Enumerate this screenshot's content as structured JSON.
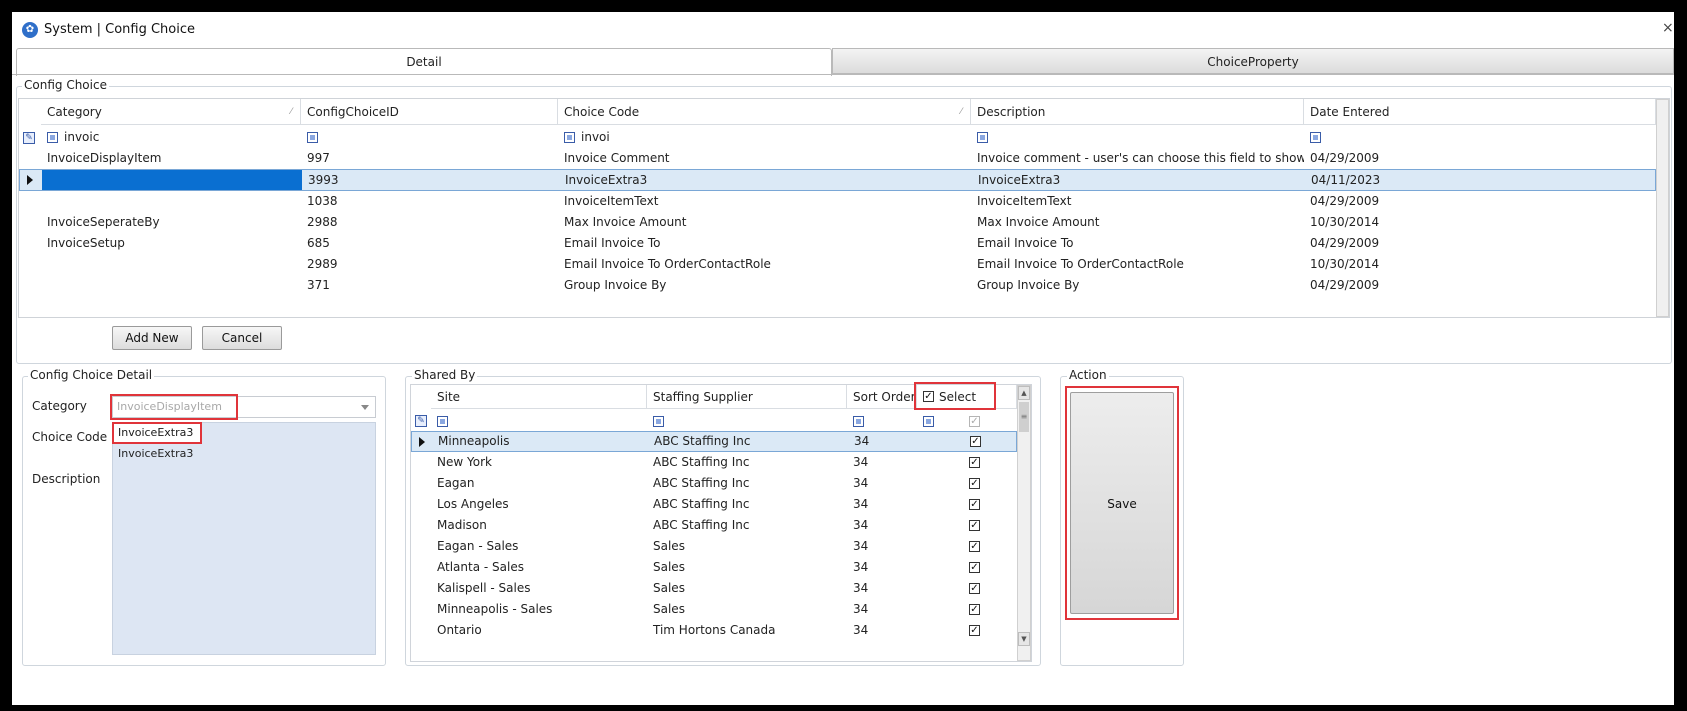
{
  "window": {
    "title": "System | Config Choice",
    "close_glyph": "×"
  },
  "tabs": [
    {
      "label": "Detail",
      "active": true
    },
    {
      "label": "ChoiceProperty",
      "active": false
    }
  ],
  "config_choice": {
    "group_label": "Config Choice",
    "columns": [
      "Category",
      "ConfigChoiceID",
      "Choice Code",
      "Description",
      "Date Entered"
    ],
    "filters": {
      "category": "invoic",
      "choice_code": "invoi"
    },
    "rows": [
      {
        "category": "InvoiceDisplayItem",
        "id": "997",
        "code": "Invoice Comment",
        "description": "Invoice comment - user's can choose this field to show...",
        "date": "04/29/2009"
      },
      {
        "category": "",
        "id": "3993",
        "code": "InvoiceExtra3",
        "description": "InvoiceExtra3",
        "date": "04/11/2023"
      },
      {
        "category": "",
        "id": "1038",
        "code": "InvoiceItemText",
        "description": "InvoiceItemText",
        "date": "04/29/2009"
      },
      {
        "category": "InvoiceSeperateBy",
        "id": "2988",
        "code": "Max Invoice Amount",
        "description": "Max Invoice Amount",
        "date": "10/30/2014"
      },
      {
        "category": "InvoiceSetup",
        "id": "685",
        "code": "Email Invoice To",
        "description": "Email Invoice To",
        "date": "04/29/2009"
      },
      {
        "category": "",
        "id": "2989",
        "code": "Email Invoice To OrderContactRole",
        "description": "Email Invoice To OrderContactRole",
        "date": "10/30/2014"
      },
      {
        "category": "",
        "id": "371",
        "code": "Group Invoice By",
        "description": "Group Invoice By",
        "date": "04/29/2009"
      }
    ],
    "add_new_label": "Add New",
    "cancel_label": "Cancel"
  },
  "detail": {
    "group_label": "Config Choice  Detail",
    "category_label": "Category",
    "category_value": "InvoiceDisplayItem",
    "choice_code_label": "Choice Code",
    "choice_code_value": "InvoiceExtra3",
    "description_label": "Description",
    "description_value": "InvoiceExtra3"
  },
  "shared_by": {
    "group_label": "Shared By",
    "columns": [
      "Site",
      "Staffing Supplier",
      "Sort Order",
      "Select"
    ],
    "rows": [
      {
        "site": "Minneapolis",
        "supplier": "ABC Staffing Inc",
        "sort": "34",
        "selected": true
      },
      {
        "site": "New York",
        "supplier": "ABC Staffing Inc",
        "sort": "34",
        "selected": true
      },
      {
        "site": "Eagan",
        "supplier": "ABC Staffing Inc",
        "sort": "34",
        "selected": true
      },
      {
        "site": "Los Angeles",
        "supplier": "ABC Staffing Inc",
        "sort": "34",
        "selected": true
      },
      {
        "site": "Madison",
        "supplier": "ABC Staffing Inc",
        "sort": "34",
        "selected": true
      },
      {
        "site": "Eagan - Sales",
        "supplier": "Sales",
        "sort": "34",
        "selected": true
      },
      {
        "site": "Atlanta - Sales",
        "supplier": "Sales",
        "sort": "34",
        "selected": true
      },
      {
        "site": "Kalispell - Sales",
        "supplier": "Sales",
        "sort": "34",
        "selected": true
      },
      {
        "site": "Minneapolis - Sales",
        "supplier": "Sales",
        "sort": "34",
        "selected": true
      },
      {
        "site": "Ontario",
        "supplier": "Tim Hortons Canada",
        "sort": "34",
        "selected": true
      }
    ]
  },
  "action": {
    "group_label": "Action",
    "save_label": "Save"
  },
  "glyphs": {
    "check": "✓",
    "edit": "✎",
    "scroll_up": "▲",
    "scroll_down": "▼",
    "grip": "≡",
    "sort": "⁄"
  },
  "colors": {
    "selection_blue": "#0a6fd1",
    "row_highlight": "#dbe9f6",
    "annotation_red": "#e0343a"
  }
}
